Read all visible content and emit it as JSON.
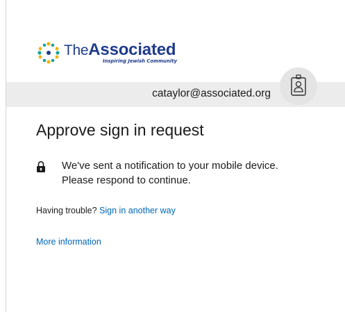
{
  "logo": {
    "the": "The",
    "associated": "Associated",
    "tagline": "Inspiring Jewish Community",
    "colors": {
      "navy": "#1f3c8c",
      "gold": "#f2b400",
      "teal": "#1aa39a"
    }
  },
  "identity": {
    "email": "cataylor@associated.org",
    "badge_icon": "id-badge-icon"
  },
  "page": {
    "title": "Approve sign in request"
  },
  "notice": {
    "icon": "lock-icon",
    "text": "We've sent a notification to your mobile device. Please respond to continue."
  },
  "help": {
    "trouble_label": "Having trouble?",
    "sign_in_another_way": "Sign in another way",
    "more_information": "More information"
  },
  "colors": {
    "link": "#0067b8",
    "identity_bar": "#ececec",
    "text": "#1b1b1b"
  }
}
